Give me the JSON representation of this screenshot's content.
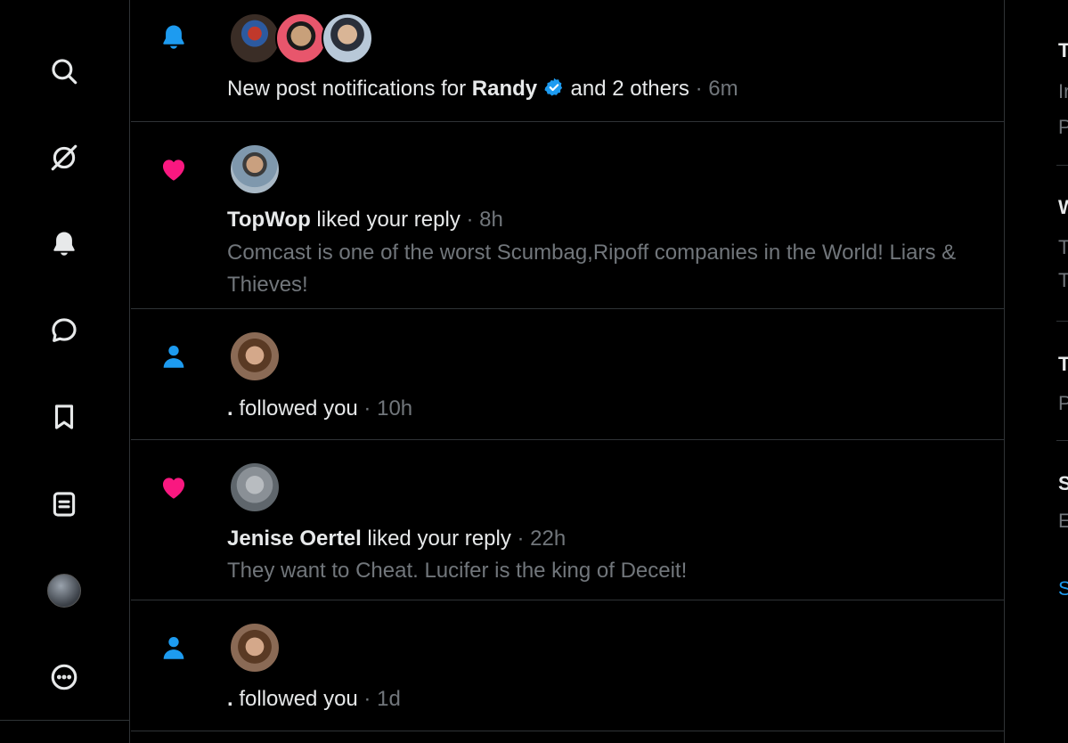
{
  "nav": {
    "items": [
      {
        "name": "search-icon"
      },
      {
        "name": "grok-icon"
      },
      {
        "name": "notifications-icon"
      },
      {
        "name": "messages-icon"
      },
      {
        "name": "bookmarks-icon"
      },
      {
        "name": "lists-icon"
      },
      {
        "name": "profile-avatar"
      },
      {
        "name": "more-icon"
      }
    ]
  },
  "notifications": [
    {
      "type": "subscription",
      "icon": "bell-icon",
      "prefix": "New post notifications for ",
      "user": "Randy",
      "verified": true,
      "suffix": " and 2 others",
      "time": "6m"
    },
    {
      "type": "like",
      "icon": "heart-icon",
      "user": "TopWop",
      "action": " liked your reply",
      "time": "8h",
      "text": "Comcast is one of the worst Scumbag,Ripoff  companies in the World! Liars & Thieves!"
    },
    {
      "type": "follow",
      "icon": "person-icon",
      "user": ".",
      "action": " followed you",
      "time": "10h"
    },
    {
      "type": "like",
      "icon": "heart-icon",
      "user": "Jenise Oertel",
      "action": " liked your reply",
      "time": "22h",
      "text": "They want to Cheat. Lucifer is the king of Deceit!"
    },
    {
      "type": "follow",
      "icon": "person-icon",
      "user": ".",
      "action": " followed you",
      "time": "1d"
    }
  ],
  "separator": " · ",
  "right_sidebar": {
    "fragments": [
      "T",
      "Ir",
      "P",
      "W",
      "T",
      "T",
      "T",
      "P",
      "S",
      "E",
      "S"
    ]
  },
  "colors": {
    "like": "#f91880",
    "accent": "#1d9bf0",
    "muted": "#71767b",
    "text": "#e7e9ea",
    "border": "#2f3336"
  }
}
